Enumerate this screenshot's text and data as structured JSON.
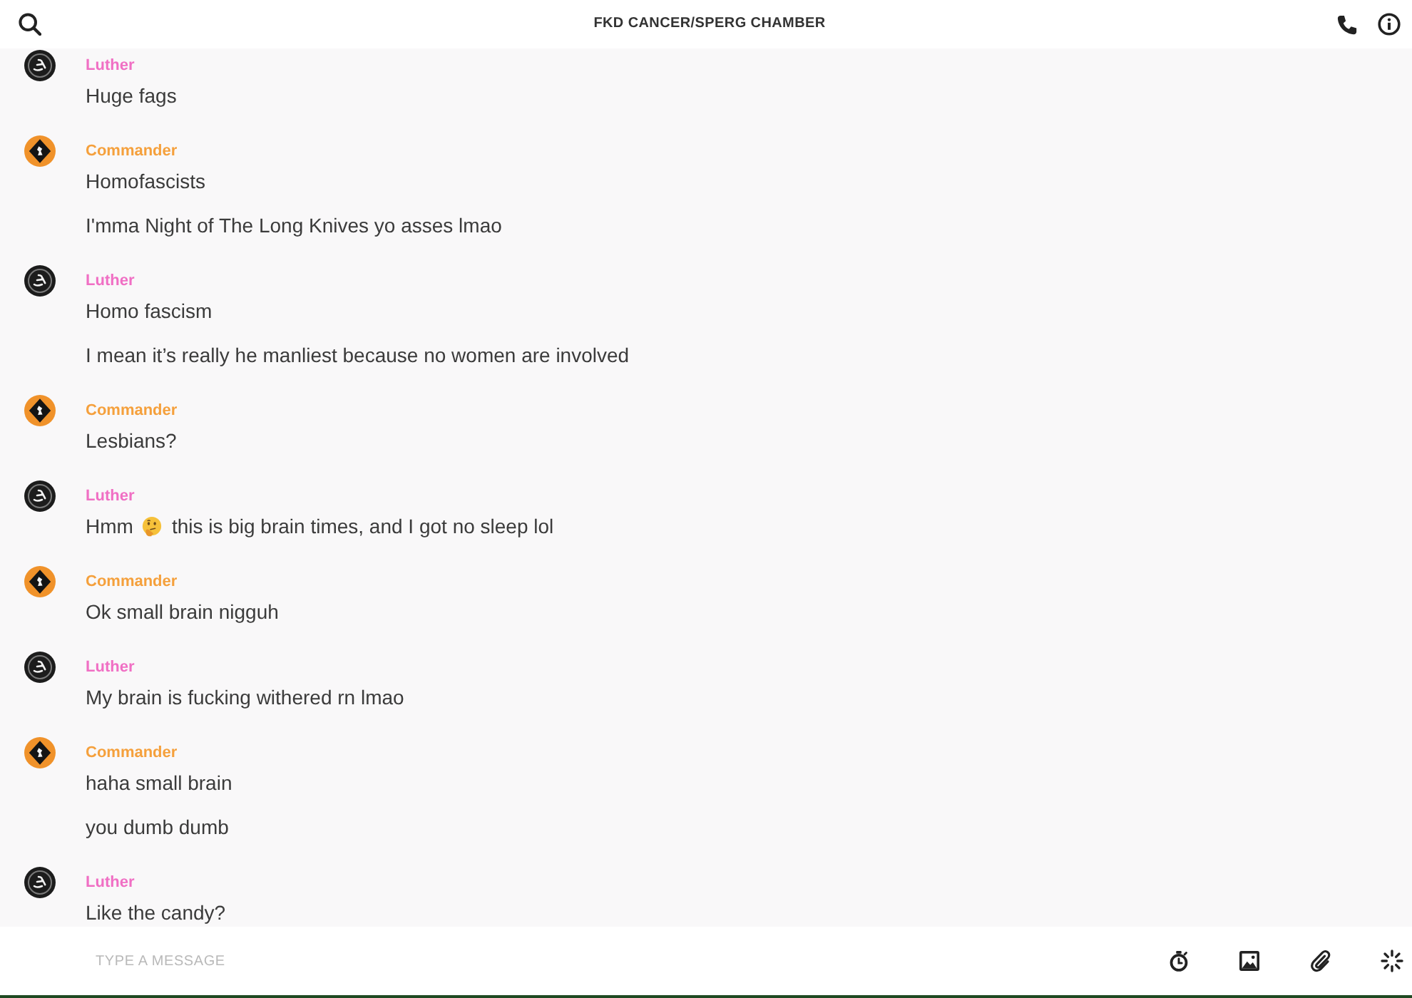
{
  "header": {
    "title": "FKD CANCER/SPERG CHAMBER"
  },
  "groups": [
    {
      "sender": "Luther",
      "kind": "disc",
      "color": "#f06fc4",
      "messages": [
        {
          "text": "Huge fags"
        }
      ]
    },
    {
      "sender": "Commander",
      "kind": "diamond",
      "color": "#f5a03c",
      "messages": [
        {
          "text": "Homofascists"
        },
        {
          "text": "I'mma Night of The Long Knives yo asses lmao"
        }
      ]
    },
    {
      "sender": "Luther",
      "kind": "disc",
      "color": "#f06fc4",
      "messages": [
        {
          "text": "Homo fascism"
        },
        {
          "text": "I mean it’s really he manliest because no women are involved"
        }
      ]
    },
    {
      "sender": "Commander",
      "kind": "diamond",
      "color": "#f5a03c",
      "messages": [
        {
          "text": "Lesbians?"
        }
      ]
    },
    {
      "sender": "Luther",
      "kind": "disc",
      "color": "#f06fc4",
      "messages": [
        {
          "segments": [
            {
              "kind": "text",
              "text": "Hmm"
            },
            {
              "kind": "emoji"
            },
            {
              "kind": "text",
              "text": "this is big brain times, and I got no sleep lol"
            }
          ]
        }
      ]
    },
    {
      "sender": "Commander",
      "kind": "diamond",
      "color": "#f5a03c",
      "messages": [
        {
          "text": "Ok small brain nigguh"
        }
      ]
    },
    {
      "sender": "Luther",
      "kind": "disc",
      "color": "#f06fc4",
      "messages": [
        {
          "text": "My brain is fucking withered rn lmao"
        }
      ]
    },
    {
      "sender": "Commander",
      "kind": "diamond",
      "color": "#f5a03c",
      "messages": [
        {
          "text": "haha small brain"
        },
        {
          "text": "you dumb dumb"
        }
      ]
    },
    {
      "sender": "Luther",
      "kind": "disc",
      "color": "#f06fc4",
      "messages": [
        {
          "text": "Like the candy?"
        }
      ]
    }
  ],
  "composer": {
    "placeholder": "TYPE A MESSAGE"
  }
}
